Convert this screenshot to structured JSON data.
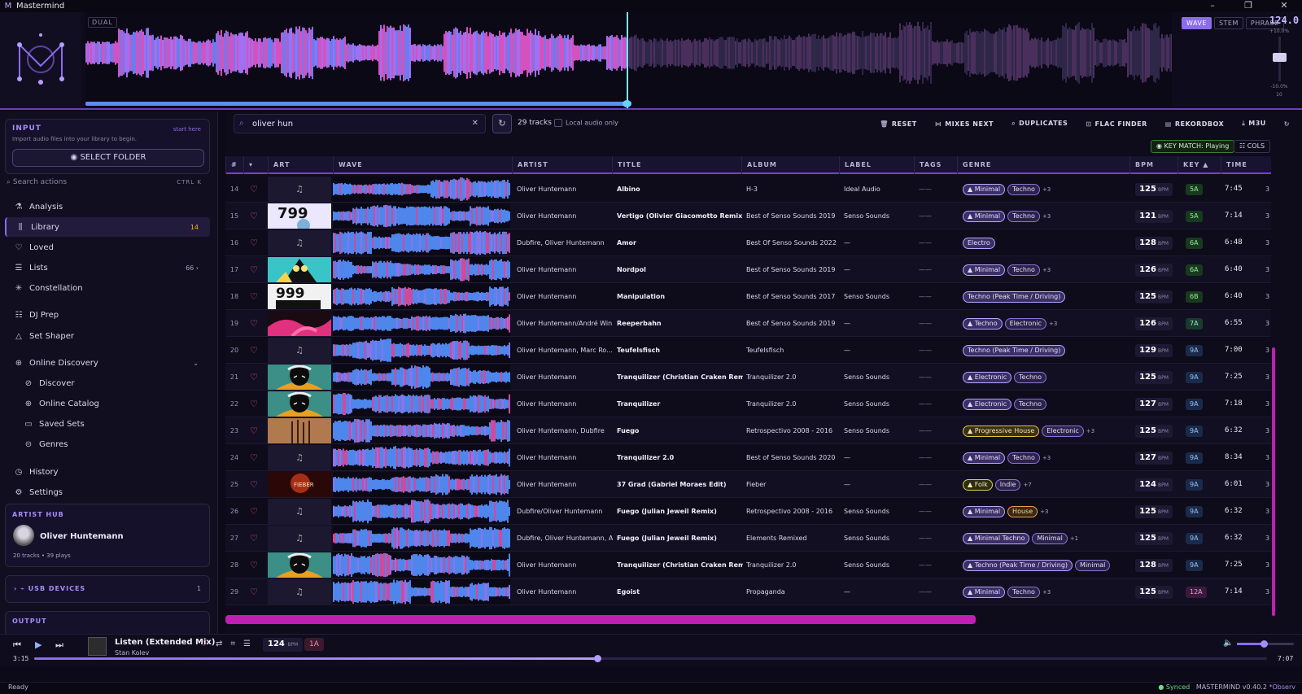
{
  "app": {
    "title": "Mastermind",
    "window_controls": [
      "–",
      "❐",
      "✕"
    ]
  },
  "deck": {
    "dual_label": "DUAL",
    "modes": [
      "WAVE",
      "STEM",
      "PHRASE"
    ],
    "active_mode": "WAVE",
    "tempo": "124.0",
    "pitch_top": "+10.0%",
    "pitch_mid": "-10.0%",
    "pitch_val": "10",
    "progress": 0.5
  },
  "sidebar": {
    "input": {
      "label": "INPUT",
      "shortcut": "start here",
      "sub": "Import audio files into your library to begin.",
      "button": "SELECT FOLDER"
    },
    "search_placeholder": "Search actions",
    "search_shortcut": "CTRL  K",
    "items": [
      {
        "label": "Analysis",
        "icon": "⚗",
        "name": "analysis-icon",
        "count": ""
      },
      {
        "label": "Library",
        "icon": "⫼",
        "name": "library-icon",
        "count": "14"
      },
      {
        "label": "Loved",
        "icon": "♡",
        "name": "heart-icon",
        "count": ""
      },
      {
        "label": "Lists",
        "icon": "☰",
        "name": "list-icon",
        "count": "66  ›"
      },
      {
        "label": "Constellation",
        "icon": "✳",
        "name": "constellation-icon",
        "count": ""
      },
      {
        "label": "DJ Prep",
        "icon": "☷",
        "name": "dj-prep-icon",
        "count": ""
      },
      {
        "label": "Set Shaper",
        "icon": "△",
        "name": "set-shaper-icon",
        "count": ""
      },
      {
        "label": "Online Discovery",
        "icon": "⊕",
        "name": "globe-icon",
        "count": "⌄"
      },
      {
        "label": "Discover",
        "icon": "⊘",
        "name": "compass-icon",
        "count": ""
      },
      {
        "label": "Online Catalog",
        "icon": "⊕",
        "name": "catalog-icon",
        "count": ""
      },
      {
        "label": "Saved Sets",
        "icon": "▭",
        "name": "saved-sets-icon",
        "count": ""
      },
      {
        "label": "Genres",
        "icon": "⊝",
        "name": "genres-icon",
        "count": ""
      },
      {
        "label": "History",
        "icon": "◷",
        "name": "history-icon",
        "count": ""
      },
      {
        "label": "Settings",
        "icon": "⚙",
        "name": "gear-icon",
        "count": ""
      }
    ],
    "hub": {
      "label": "ARTIST HUB",
      "name": "Oliver Huntemann",
      "stats": "20 tracks • 39 plays"
    },
    "usb": {
      "label": "›  ⌁  USB DEVICES",
      "count": "1"
    },
    "output": {
      "label": "OUTPUT"
    }
  },
  "toolbar": {
    "query": "oliver hun",
    "track_count": "29 tracks",
    "local_only": "Local audio only",
    "buttons": [
      "RESET",
      "MIXES NEXT",
      "DUPLICATES",
      "FLAC FINDER",
      "REKORDBOX",
      "M3U"
    ],
    "key_match": "KEY MATCH: Playing",
    "cols": "COLS"
  },
  "table": {
    "headers": [
      "#",
      "▾",
      "ART",
      "WAVE",
      "ARTIST",
      "TITLE",
      "ALBUM",
      "LABEL",
      "TAGS",
      "GENRE",
      "BPM",
      "KEY ▲",
      "TIME"
    ],
    "rows": [
      {
        "n": "14",
        "art": "note",
        "artist": "Oliver Huntemann",
        "title": "Albino",
        "album": "H-3",
        "label": "Ideal Audio",
        "genres": [
          "Minimal",
          "Techno"
        ],
        "more": "+3",
        "bpm": "125",
        "key": "5A",
        "time": "7:45"
      },
      {
        "n": "15",
        "art": "799",
        "artist": "Oliver Huntemann",
        "title": "Vertigo (Olivier Giacomotto Remix)",
        "album": "Best of Senso Sounds 2019",
        "label": "Senso Sounds",
        "genres": [
          "Minimal",
          "Techno"
        ],
        "more": "+3",
        "bpm": "121",
        "key": "5A",
        "time": "7:14"
      },
      {
        "n": "16",
        "art": "note",
        "artist": "Dubfire, Oliver Huntemann",
        "title": "Amor",
        "album": "Best Of Senso Sounds 2022",
        "label": "—",
        "genres": [
          "Electro"
        ],
        "more": "",
        "bpm": "128",
        "key": "6A",
        "time": "6:48"
      },
      {
        "n": "17",
        "art": "bird",
        "artist": "Oliver Huntemann",
        "title": "Nordpol",
        "album": "Best of Senso Sounds 2019",
        "label": "—",
        "genres": [
          "Minimal",
          "Techno"
        ],
        "more": "+3",
        "bpm": "126",
        "key": "6A",
        "time": "6:40"
      },
      {
        "n": "18",
        "art": "999",
        "artist": "Oliver Huntemann",
        "title": "Manipulation",
        "album": "Best of Senso Sounds 2017",
        "label": "Senso Sounds",
        "genres": [
          "Techno (Peak Time / Driving)"
        ],
        "more": "",
        "bpm": "125",
        "key": "6B",
        "time": "6:40"
      },
      {
        "n": "19",
        "art": "hands",
        "artist": "Oliver Huntemann/André Win...",
        "title": "Reeperbahn",
        "album": "Best of Senso Sounds 2019",
        "label": "—",
        "genres": [
          "Techno",
          "Electronic"
        ],
        "more": "+3",
        "bpm": "126",
        "key": "7A",
        "time": "6:55"
      },
      {
        "n": "20",
        "art": "note",
        "artist": "Oliver Huntemann, Marc Ro...",
        "title": "Teufelsfisch",
        "album": "Teufelsfisch",
        "label": "—",
        "genres": [
          "Techno (Peak Time / Driving)"
        ],
        "more": "",
        "bpm": "129",
        "key": "9A",
        "time": "7:00"
      },
      {
        "n": "21",
        "art": "mask",
        "artist": "Oliver Huntemann",
        "title": "Tranquilizer (Christian Craken Remix)",
        "album": "Tranquilizer 2.0",
        "label": "Senso Sounds",
        "genres": [
          "Electronic",
          "Techno"
        ],
        "more": "",
        "bpm": "125",
        "key": "9A",
        "time": "7:25"
      },
      {
        "n": "22",
        "art": "mask",
        "artist": "Oliver Huntemann",
        "title": "Tranquilizer",
        "album": "Tranquilizer 2.0",
        "label": "Senso Sounds",
        "genres": [
          "Electronic",
          "Techno"
        ],
        "more": "",
        "bpm": "127",
        "key": "9A",
        "time": "7:18"
      },
      {
        "n": "23",
        "art": "fuego",
        "artist": "Oliver Huntemann, Dubfire",
        "title": "Fuego",
        "album": "Retrospectivo 2008 - 2016",
        "label": "Senso Sounds",
        "genres": [
          "Progressive House",
          "Electronic"
        ],
        "more": "+3",
        "bpm": "125",
        "key": "9A",
        "time": "6:32"
      },
      {
        "n": "24",
        "art": "note",
        "artist": "Oliver Huntemann",
        "title": "Tranquilizer 2.0",
        "album": "Best of Senso Sounds 2020",
        "label": "—",
        "genres": [
          "Minimal",
          "Techno"
        ],
        "more": "+3",
        "bpm": "127",
        "key": "9A",
        "time": "8:34"
      },
      {
        "n": "25",
        "art": "fieber",
        "artist": "Oliver Huntemann",
        "title": "37 Grad (Gabriel Moraes Edit)",
        "album": "Fieber",
        "label": "—",
        "genres": [
          "Folk",
          "Indie"
        ],
        "more": "+7",
        "bpm": "124",
        "key": "9A",
        "time": "6:01"
      },
      {
        "n": "26",
        "art": "note",
        "artist": "Dubfire/Oliver Huntemann",
        "title": "Fuego (Julian Jeweil Remix)",
        "album": "Retrospectivo 2008 - 2016",
        "label": "Senso Sounds",
        "genres": [
          "Minimal",
          "House"
        ],
        "more": "+3",
        "bpm": "125",
        "key": "9A",
        "time": "6:32"
      },
      {
        "n": "27",
        "art": "note",
        "artist": "Dubfire, Oliver Huntemann, A...",
        "title": "Fuego (Julian Jeweil Remix)",
        "album": "Elements Remixed",
        "label": "Senso Sounds",
        "genres": [
          "Minimal Techno",
          "Minimal"
        ],
        "more": "+1",
        "bpm": "125",
        "key": "9A",
        "time": "6:32"
      },
      {
        "n": "28",
        "art": "mask",
        "artist": "Oliver Huntemann",
        "title": "Tranquilizer (Christian Craken Remix)",
        "album": "Tranquilizer 2.0",
        "label": "Senso Sounds",
        "genres": [
          "Techno (Peak Time / Driving)",
          "Minimal"
        ],
        "more": "",
        "bpm": "128",
        "key": "9A",
        "time": "7:25"
      },
      {
        "n": "29",
        "art": "note",
        "artist": "Oliver Huntemann",
        "title": "Egoist",
        "album": "Propaganda",
        "label": "—",
        "genres": [
          "Minimal",
          "Techno"
        ],
        "more": "+3",
        "bpm": "125",
        "key": "12A",
        "time": "7:14"
      }
    ],
    "bpm_unit": "BPM",
    "tags_placeholder": "——",
    "extra_col": "3"
  },
  "player": {
    "title": "Listen (Extended Mix)",
    "artist": "Stan Kolev",
    "bpm": "124",
    "bpm_unit": "BPM",
    "key": "1A",
    "elapsed": "3:15",
    "total": "7:07",
    "progress": 0.46,
    "volume": 0.45
  },
  "status": {
    "left": "Ready",
    "synced": "● Synced",
    "version": "MASTERMIND v0.40.2",
    "observ": "*Observ"
  },
  "colors": {
    "accent": "#8b6cf0",
    "pink": "#c01fb4",
    "key_green": "#173a1e",
    "key_blue": "#1a2a4a"
  }
}
